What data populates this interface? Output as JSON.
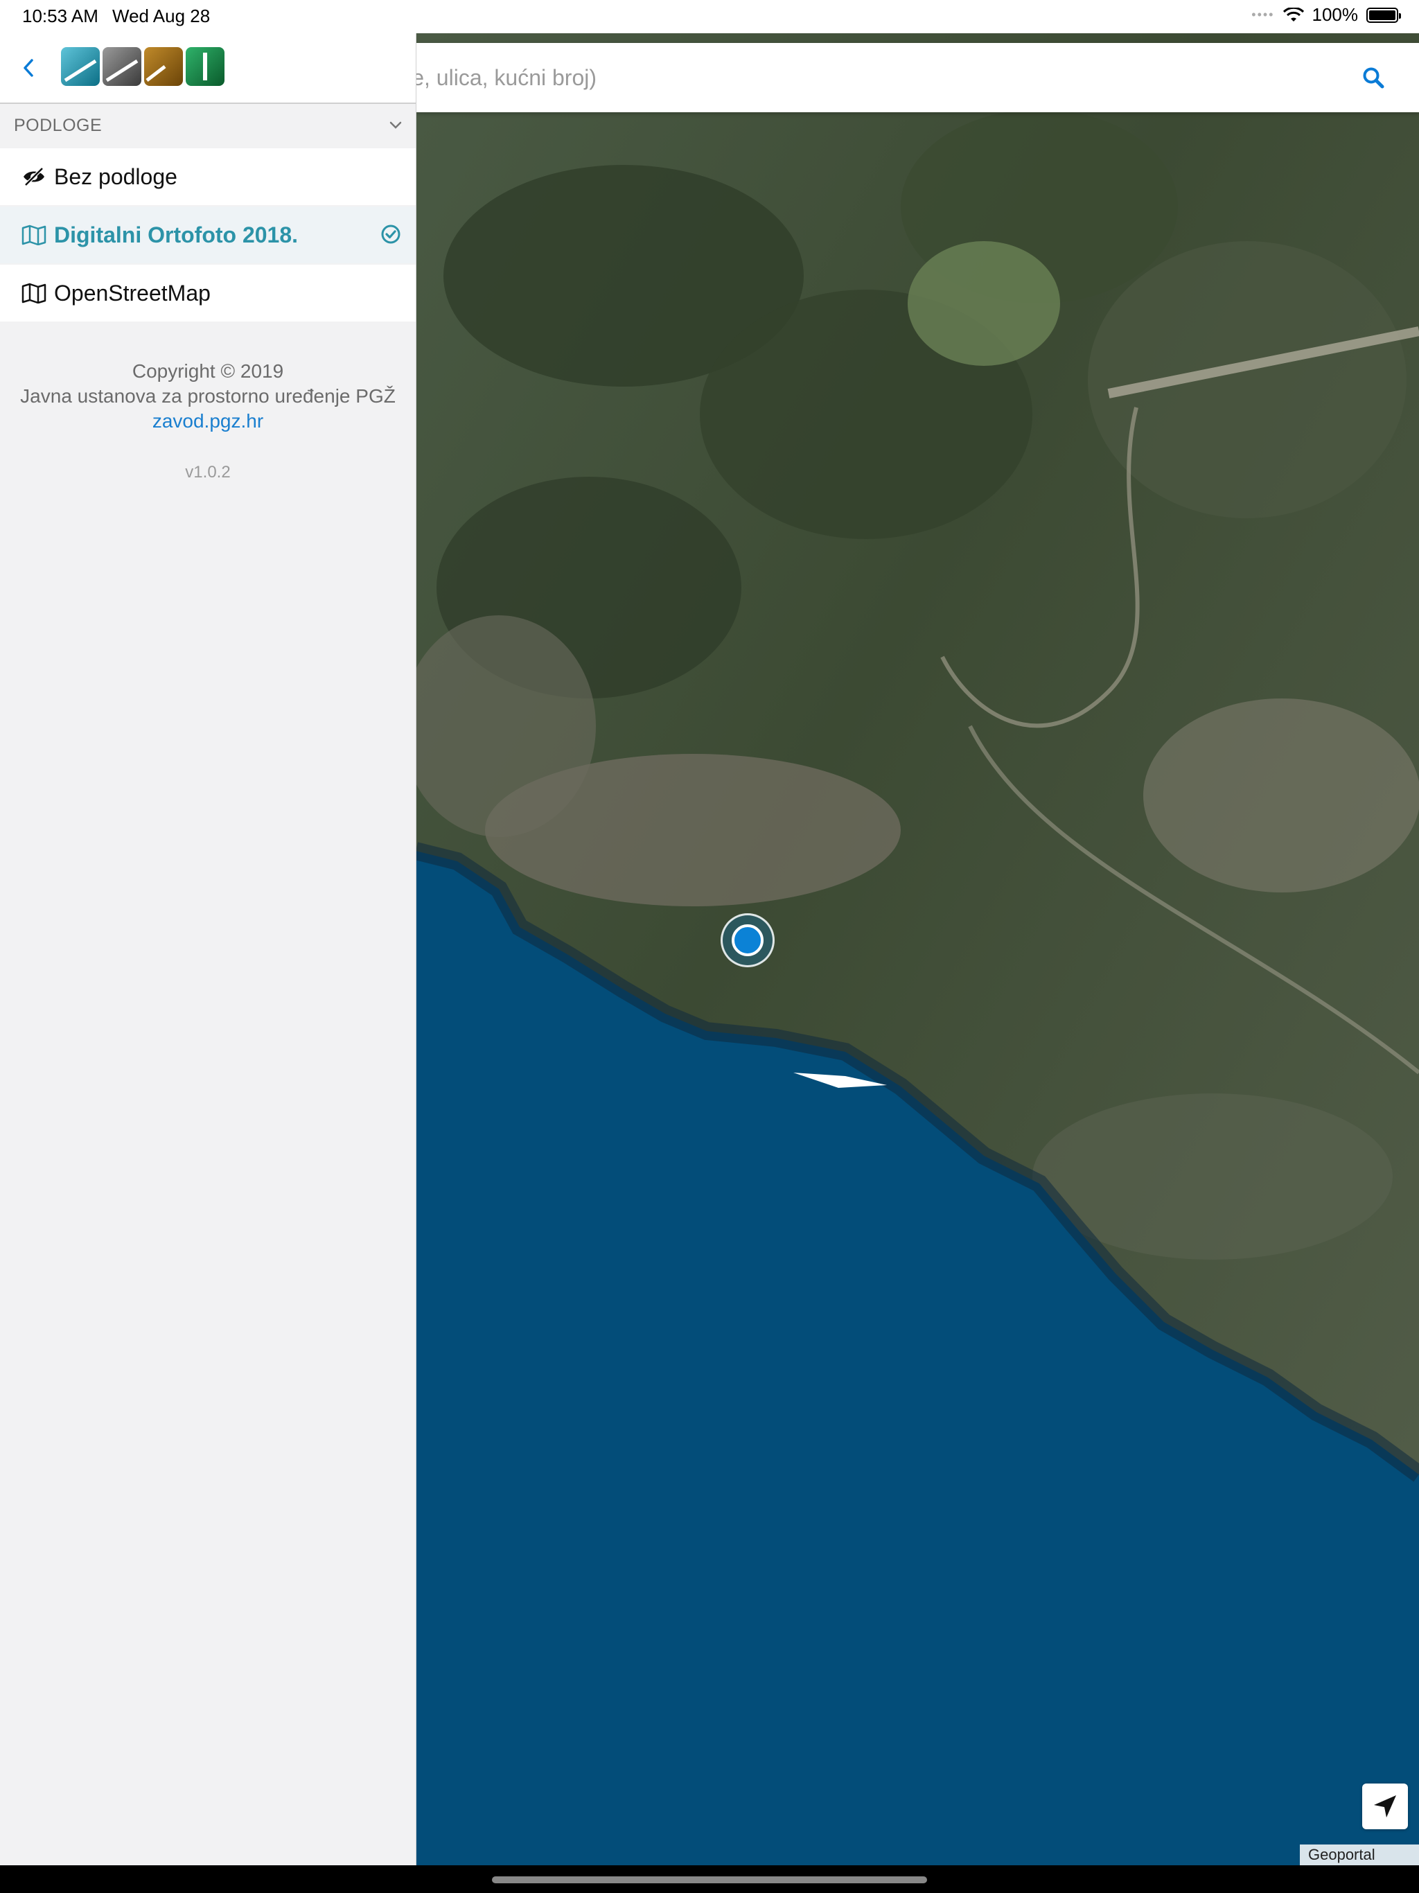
{
  "status_bar": {
    "time": "10:53 AM",
    "date": "Wed Aug 28",
    "battery": "100%"
  },
  "search": {
    "placeholder": "Mjesto, naselje, ulica, kućni broj)",
    "visible_placeholder": "lje, ulica, kućni broj)"
  },
  "sidebar": {
    "section_title": "PODLOGE",
    "layers": [
      {
        "label": "Bez podloge",
        "icon": "eye-slash-icon",
        "active": false
      },
      {
        "label": "Digitalni Ortofoto 2018.",
        "icon": "map-icon",
        "active": true
      },
      {
        "label": "OpenStreetMap",
        "icon": "map-icon",
        "active": false
      }
    ],
    "copyright": "Copyright © 2019",
    "institution": "Javna ustanova za prostorno uređenje PGŽ",
    "link": "zavod.pgz.hr",
    "version": "v1.0.2"
  },
  "map": {
    "attribution": "Geoportal DGU"
  },
  "colors": {
    "accent": "#2c93a8",
    "link": "#1a7fcf",
    "sea": "#034d79",
    "land": "#3d4a35"
  }
}
